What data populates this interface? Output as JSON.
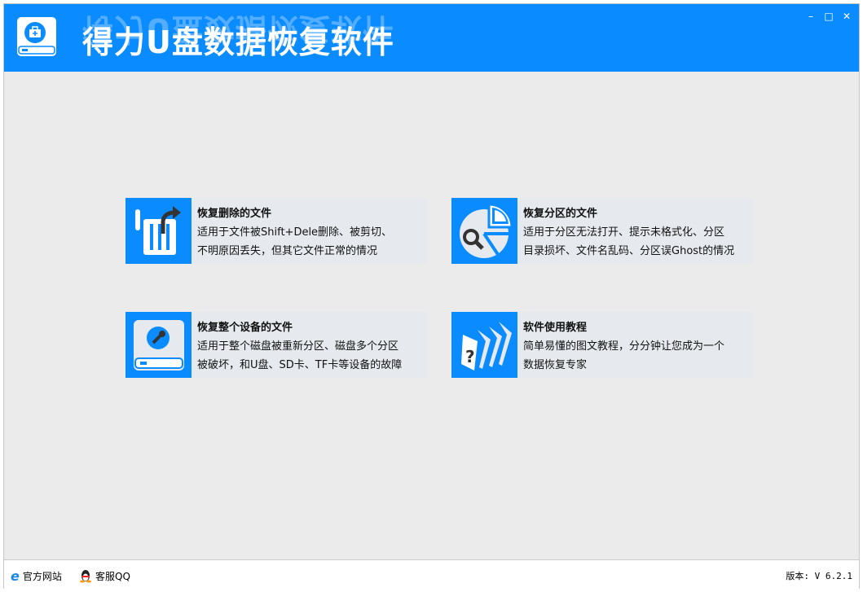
{
  "header": {
    "title": "得力U盘数据恢复软件",
    "minimize": "–",
    "maximize": "□",
    "close": "✕"
  },
  "cards": [
    {
      "title": "恢复删除的文件",
      "line1": "适用于文件被Shift+Dele删除、被剪切、",
      "line2": "不明原因丢失，但其它文件正常的情况",
      "icon": "trash-restore-icon"
    },
    {
      "title": "恢复分区的文件",
      "line1": "适用于分区无法打开、提示未格式化、分区",
      "line2": "目录损坏、文件名乱码、分区误Ghost的情况",
      "icon": "partition-search-icon"
    },
    {
      "title": "恢复整个设备的文件",
      "line1": "适用于整个磁盘被重新分区、磁盘多个分区",
      "line2": "被破坏，和U盘、SD卡、TF卡等设备的故障",
      "icon": "disk-repair-icon"
    },
    {
      "title": "软件使用教程",
      "line1": "简单易懂的图文教程，分分钟让您成为一个",
      "line2": "数据恢复专家",
      "icon": "tutorial-icon"
    }
  ],
  "footer": {
    "website": "官方网站",
    "qq": "客服QQ",
    "version": "版本: V 6.2.1"
  },
  "colors": {
    "brand": "#0a8bff"
  }
}
